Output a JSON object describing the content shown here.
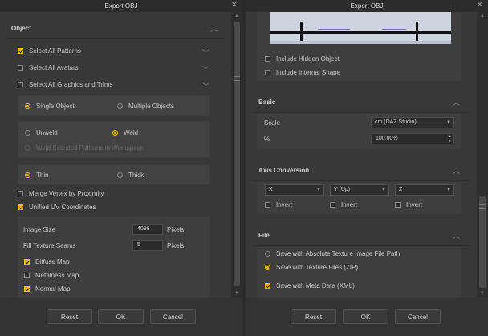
{
  "left": {
    "title": "Export OBJ",
    "object_section": {
      "title": "Object",
      "select_all_patterns": "Select All Patterns",
      "select_all_avatars": "Select All Avatars",
      "select_all_graphics": "Select All Graphics and Trims",
      "single_object": "Single Object",
      "multiple_objects": "Multiple Objects",
      "unweld": "Unweld",
      "weld": "Weld",
      "weld_selected": "Weld Selected Patterns in Workspace",
      "thin": "Thin",
      "thick": "Thick",
      "merge_vertex": "Merge Vertex by Proximity",
      "unified_uv": "Unified UV Coordinates",
      "image_size_label": "Image Size",
      "image_size_value": "4096",
      "image_size_unit": "Pixels",
      "fill_seams_label": "Fill Texture Seams",
      "fill_seams_value": "5",
      "fill_seams_unit": "Pixels",
      "diffuse_map": "Diffuse Map",
      "metalness_map": "Metalness Map",
      "normal_map": "Normal Map"
    },
    "buttons": {
      "reset": "Reset",
      "ok": "OK",
      "cancel": "Cancel"
    }
  },
  "right": {
    "title": "Export OBJ",
    "include_hidden": "Include Hidden Object",
    "include_internal": "Include Internal Shape",
    "basic": {
      "title": "Basic",
      "scale_label": "Scale",
      "scale_value": "cm (DAZ Studio)",
      "percent_label": "%",
      "percent_value": "100,00%"
    },
    "axis": {
      "title": "Axis Conversion",
      "x_value": "X",
      "y_value": "Y (Up)",
      "z_value": "Z",
      "invert": "Invert"
    },
    "file": {
      "title": "File",
      "absolute_path": "Save with Absolute Texture Image File Path",
      "texture_files": "Save with Texture Files (ZIP)",
      "meta_data": "Save with Meta Data (XML)"
    },
    "buttons": {
      "reset": "Reset",
      "ok": "OK",
      "cancel": "Cancel"
    }
  },
  "icons": {
    "close": "close-icon",
    "chevron_up": "chevron-up-icon",
    "chevron_down": "chevron-down-icon"
  },
  "colors": {
    "accent": "#f5b81a",
    "background": "#333333",
    "panel": "#424242"
  }
}
